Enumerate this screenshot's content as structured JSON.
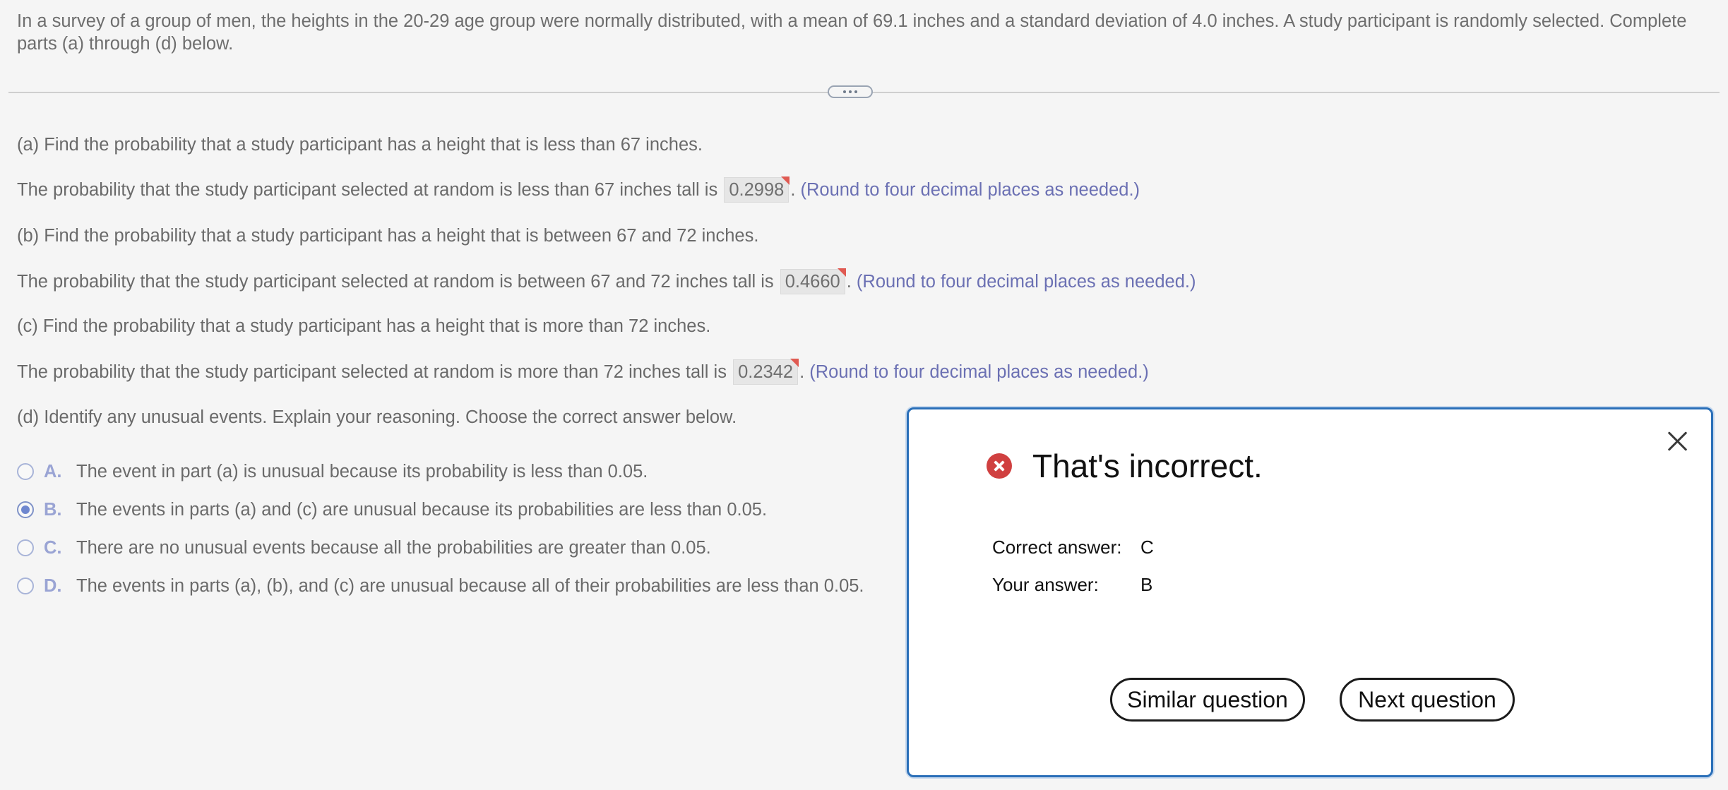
{
  "intro": "In a survey of a group of men, the heights in the 20-29 age group were normally distributed, with a mean of 69.1 inches and a standard deviation of 4.0 inches. A study participant is randomly selected. Complete parts (a) through (d) below.",
  "parts": {
    "a": {
      "question": "(a) Find the probability that a study participant has a height that is less than 67 inches.",
      "answer_prefix": "The probability that the study participant selected at random is less than 67 inches tall is",
      "answer_value": "0.2998",
      "answer_suffix": ".",
      "hint": "(Round to four decimal places as needed.)"
    },
    "b": {
      "question": "(b) Find the probability that a study participant has a height that is between 67 and 72 inches.",
      "answer_prefix": "The probability that the study participant selected at random is between 67 and 72 inches tall is",
      "answer_value": "0.4660",
      "answer_suffix": ".",
      "hint": "(Round to four decimal places as needed.)"
    },
    "c": {
      "question": "(c) Find the probability that a study participant has a height that is more than 72 inches.",
      "answer_prefix": "The probability that the study participant selected at random is more than 72 inches tall is",
      "answer_value": "0.2342",
      "answer_suffix": ".",
      "hint": "(Round to four decimal places as needed.)"
    },
    "d": {
      "question": "(d) Identify any unusual events. Explain your reasoning. Choose the correct answer below."
    }
  },
  "choices": [
    {
      "letter": "A.",
      "text": "The event in part (a) is unusual because its probability is less than 0.05.",
      "selected": false
    },
    {
      "letter": "B.",
      "text": "The events in parts (a) and (c) are unusual because its probabilities are less than 0.05.",
      "selected": true
    },
    {
      "letter": "C.",
      "text": "There are no unusual events because all the probabilities are greater than 0.05.",
      "selected": false
    },
    {
      "letter": "D.",
      "text": "The events in parts (a), (b), and (c) are unusual because all of their probabilities are  less than 0.05.",
      "selected": false
    }
  ],
  "dialog": {
    "title": "That's incorrect.",
    "correct_label": "Correct answer:",
    "correct_value": "C",
    "your_label": "Your answer:",
    "your_value": "B",
    "similar_button": "Similar question",
    "next_button": "Next question"
  },
  "icons": {
    "close": "close-icon",
    "error": "error-x-icon",
    "divider": "more-dots-icon"
  },
  "colors": {
    "hint": "#6b70b3",
    "dialog_border": "#2a6fb8",
    "error": "#d04040",
    "answer_flag": "#e05a52"
  }
}
